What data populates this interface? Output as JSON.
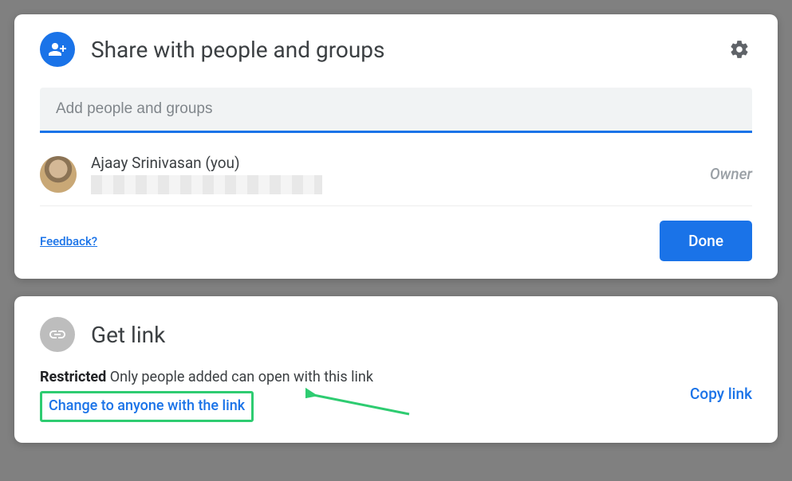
{
  "share": {
    "title": "Share with people and groups",
    "input_placeholder": "Add people and groups",
    "person": {
      "name": "Ajaay Srinivasan (you)",
      "role": "Owner"
    },
    "feedback_label": "Feedback?",
    "done_label": "Done"
  },
  "getlink": {
    "title": "Get link",
    "restricted_label": "Restricted",
    "restricted_desc": " Only people added can open with this link",
    "change_label": "Change to anyone with the link",
    "copy_label": "Copy link"
  }
}
